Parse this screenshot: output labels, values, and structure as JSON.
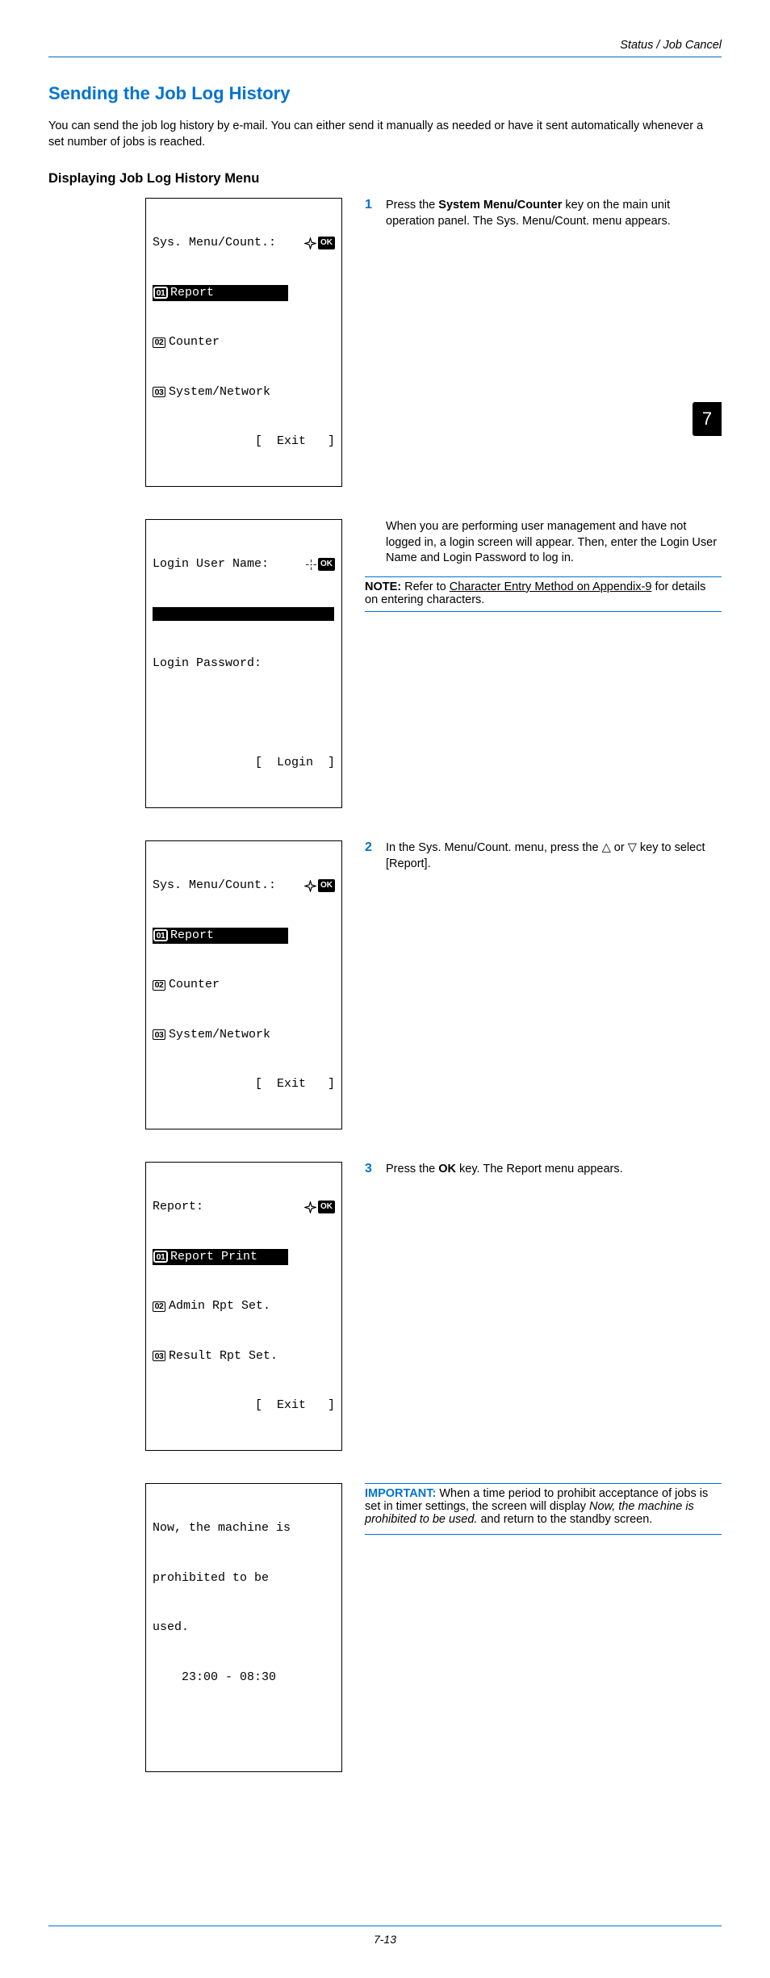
{
  "header": {
    "right": "Status / Job Cancel"
  },
  "title": "Sending the Job Log History",
  "intro": "You can send the job log history by e-mail. You can either send it manually as needed or have it sent automatically whenever a set number of jobs is reached.",
  "subhead": "Displaying Job Log History Menu",
  "panel1": {
    "title": "Sys. Menu/Count.:",
    "item1": "Report",
    "num1": "01",
    "item2": "Counter",
    "num2": "02",
    "item3": "System/Network",
    "num3": "03",
    "exit": "[  Exit   ]"
  },
  "panel2": {
    "title": "Login User Name:",
    "row2": "Login Password:",
    "login": "[  Login  ]"
  },
  "panel3": {
    "title": "Sys. Menu/Count.:",
    "item1": "Report",
    "num1": "01",
    "item2": "Counter",
    "num2": "02",
    "item3": "System/Network",
    "num3": "03",
    "exit": "[  Exit   ]"
  },
  "panel4": {
    "title": "Report:",
    "item1": "Report Print",
    "num1": "01",
    "item2": "Admin Rpt Set.",
    "num2": "02",
    "item3": "Result Rpt Set.",
    "num3": "03",
    "exit": "[  Exit   ]"
  },
  "panel5": {
    "l1": "Now, the machine is",
    "l2": "prohibited to be",
    "l3": "used.",
    "l4": "    23:00 - 08:30"
  },
  "step1": {
    "n": "1",
    "a": "Press the ",
    "b": "System Menu/Counter",
    "c": " key on the main unit operation panel. The Sys. Menu/Count. menu appears."
  },
  "para_login": "When you are performing user management and have not logged in, a login screen will appear. Then, enter the Login User Name and Login Password to log in.",
  "note": {
    "label": "NOTE:",
    "before": " Refer to ",
    "link": "Character Entry Method on Appendix-9",
    "after": " for details on entering characters."
  },
  "step2": {
    "n": "2",
    "a": "In the Sys. Menu/Count. menu, press the ",
    "tri_up": "△",
    "mid": " or ",
    "tri_down": "▽",
    "c": " key to select [Report]."
  },
  "step3": {
    "n": "3",
    "a": "Press the ",
    "b": "OK",
    "c": " key. The Report menu appears."
  },
  "important": {
    "label": "IMPORTANT:",
    "a": " When a time period to prohibit acceptance of jobs is set in timer settings, the screen will display ",
    "ital": "Now, the machine is prohibited to be used.",
    "b": " and return to the standby screen."
  },
  "tab": "7",
  "footer": "7-13",
  "icons": {
    "ok": "OK"
  }
}
